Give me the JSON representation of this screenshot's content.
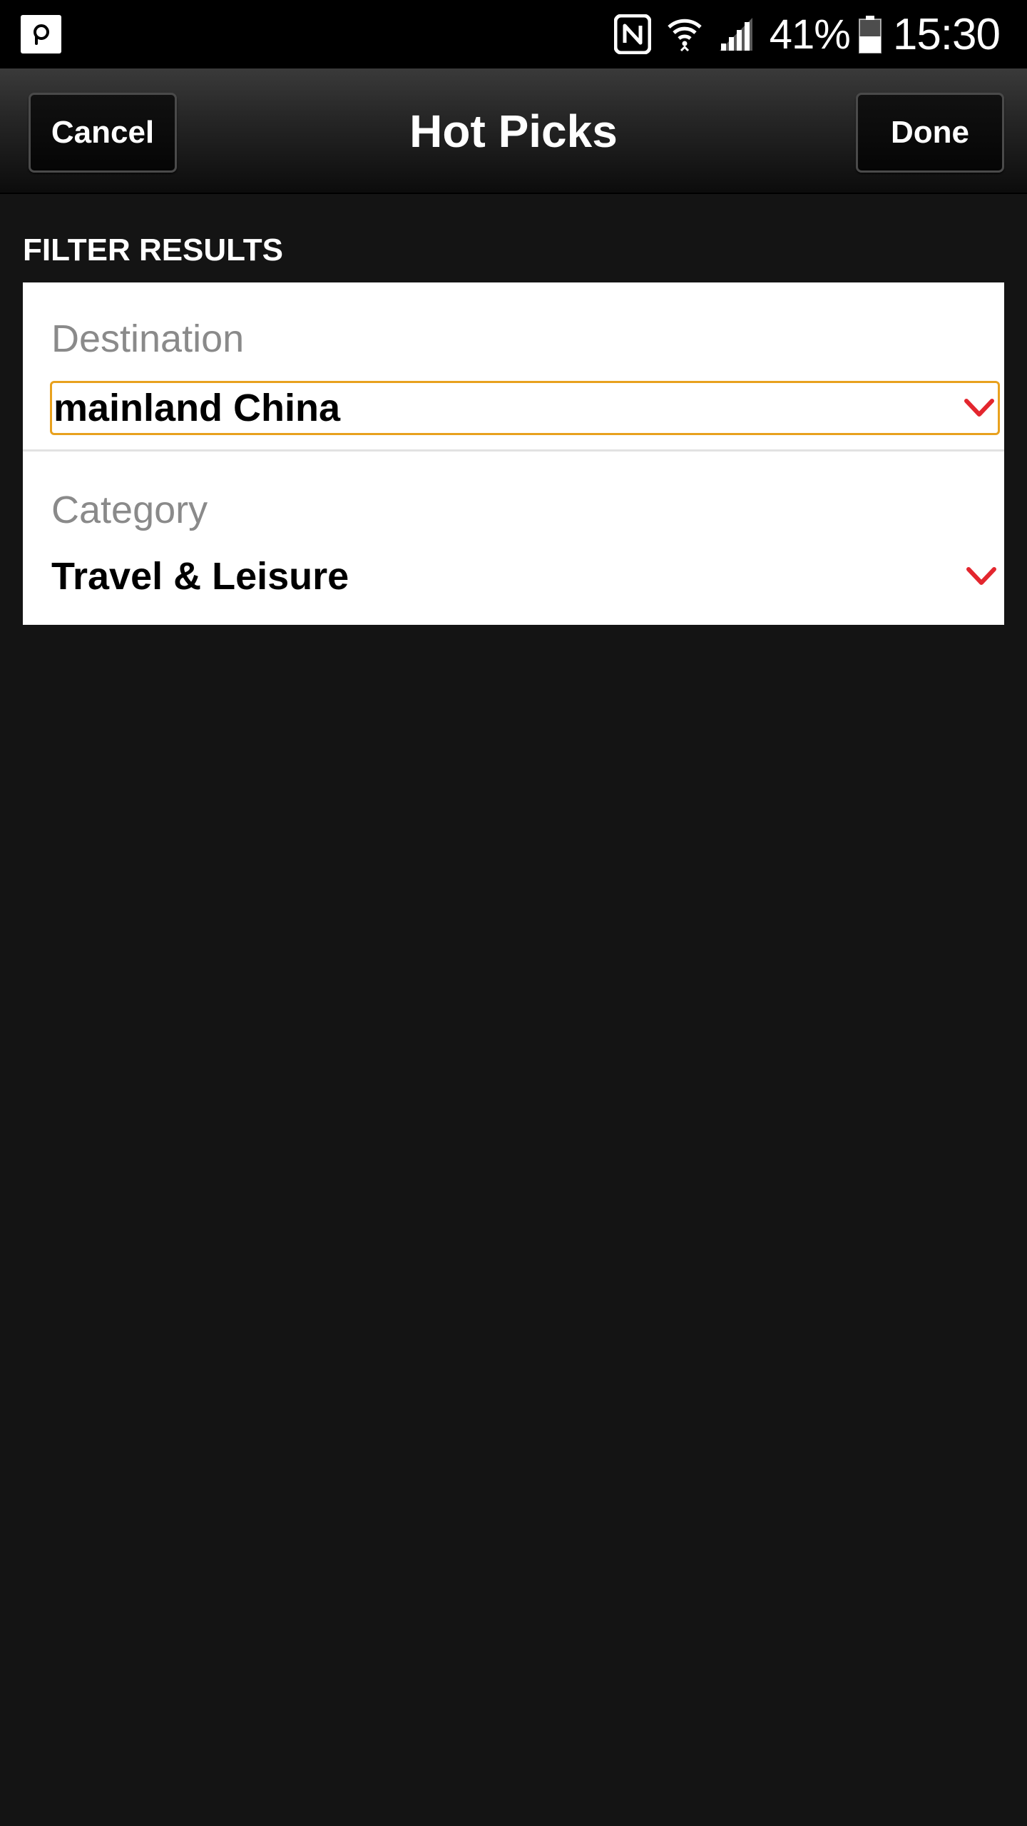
{
  "status_bar": {
    "battery_percent": "41%",
    "time": "15:30",
    "icons": [
      "app-notification-icon",
      "nfc-icon",
      "wifi-icon",
      "signal-icon",
      "battery-icon"
    ]
  },
  "header": {
    "title": "Hot Picks",
    "cancel_label": "Cancel",
    "done_label": "Done"
  },
  "filter": {
    "section_title": "FILTER RESULTS",
    "destination": {
      "label": "Destination",
      "value": "mainland China"
    },
    "category": {
      "label": "Category",
      "value": "Travel & Leisure"
    }
  },
  "colors": {
    "background": "#141414",
    "focus_border": "#e8a11e",
    "chevron": "#e3262e"
  }
}
